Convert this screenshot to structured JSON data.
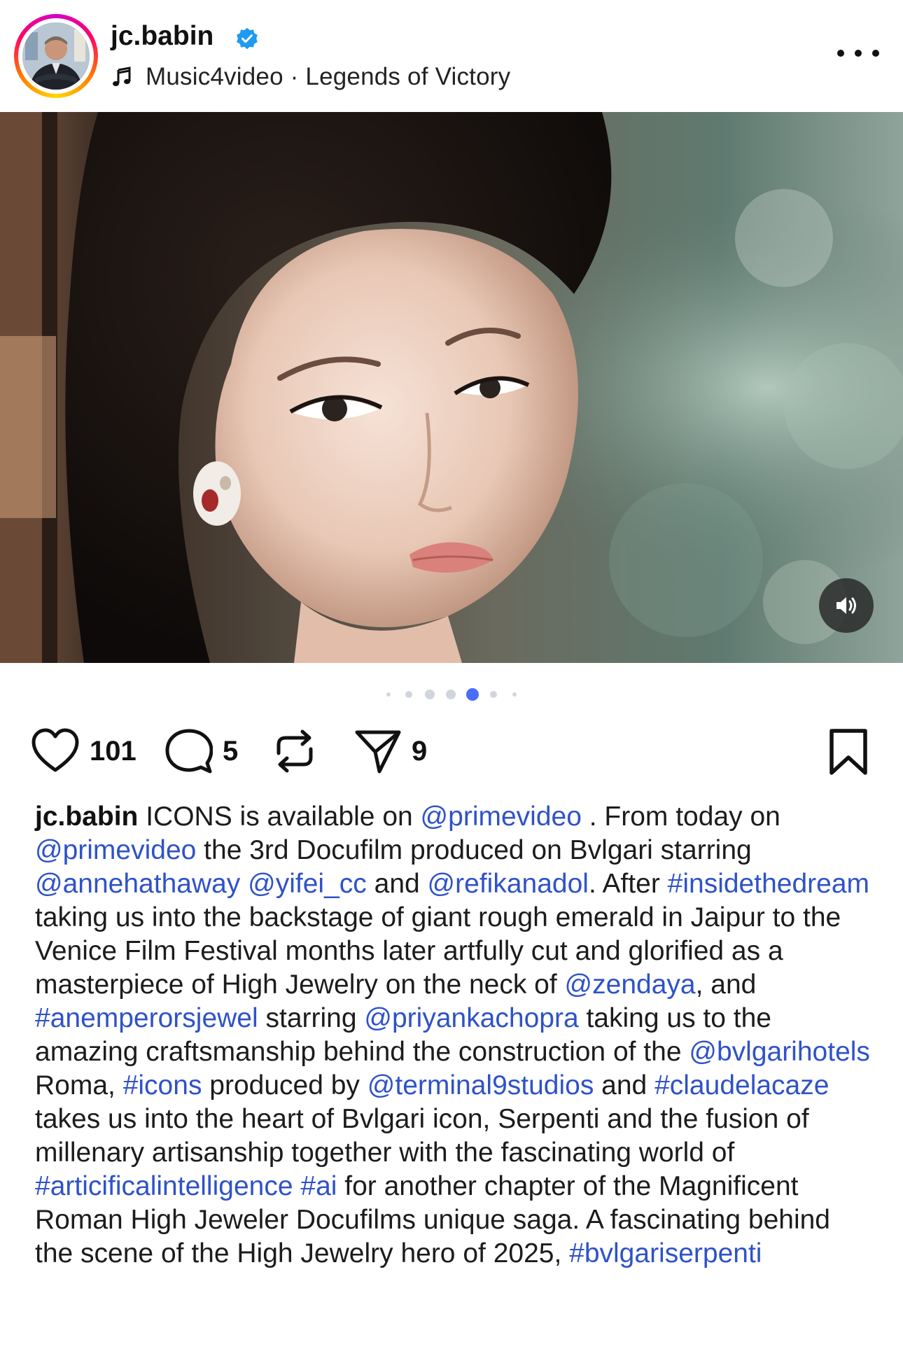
{
  "post": {
    "username": "jc.babin",
    "verified": true,
    "music_note_icon": "music-note-icon",
    "audio": "Music4video · Legends of Victory",
    "more_icon": "more-horizontal-icon"
  },
  "media": {
    "sound_icon": "speaker-volume-icon",
    "carousel_dots": 7,
    "active_dot_index": 4
  },
  "actions": {
    "likes": "101",
    "comments": "5",
    "shares": "9",
    "icons": [
      "heart-icon",
      "comment-icon",
      "repost-icon",
      "send-icon",
      "bookmark-icon"
    ]
  },
  "caption": {
    "segments": [
      {
        "t": "jc.babin",
        "k": "user"
      },
      {
        "t": " ICONS is available on ",
        "k": "text"
      },
      {
        "t": "@primevideo",
        "k": "link"
      },
      {
        "t": " . From today on ",
        "k": "text"
      },
      {
        "t": "@primevideo",
        "k": "link"
      },
      {
        "t": " the 3rd Docufilm produced on Bvlgari starring ",
        "k": "text"
      },
      {
        "t": "@annehathaway",
        "k": "link"
      },
      {
        "t": " ",
        "k": "text"
      },
      {
        "t": "@yifei_cc",
        "k": "link"
      },
      {
        "t": " and ",
        "k": "text"
      },
      {
        "t": "@refikanadol",
        "k": "link"
      },
      {
        "t": ". After ",
        "k": "text"
      },
      {
        "t": "#insidethedream",
        "k": "link"
      },
      {
        "t": " taking us into the backstage of giant rough emerald in Jaipur to the Venice Film Festival months later artfully cut and glorified as a masterpiece of High Jewelry on the neck of ",
        "k": "text"
      },
      {
        "t": "@zendaya",
        "k": "link"
      },
      {
        "t": ", and ",
        "k": "text"
      },
      {
        "t": "#anemperorsjewel",
        "k": "link"
      },
      {
        "t": " starring ",
        "k": "text"
      },
      {
        "t": "@priyankachopra",
        "k": "link"
      },
      {
        "t": " taking us to the amazing craftsmanship behind the construction of the ",
        "k": "text"
      },
      {
        "t": "@bvlgarihotels",
        "k": "link"
      },
      {
        "t": " Roma, ",
        "k": "text"
      },
      {
        "t": "#icons",
        "k": "link"
      },
      {
        "t": " produced by ",
        "k": "text"
      },
      {
        "t": "@terminal9studios",
        "k": "link"
      },
      {
        "t": " and ",
        "k": "text"
      },
      {
        "t": "#claudelacaze",
        "k": "link"
      },
      {
        "t": " takes us into the heart of Bvlgari icon, Serpenti and the fusion of millenary artisanship together with the fascinating world of ",
        "k": "text"
      },
      {
        "t": "#articificalintelligence",
        "k": "link"
      },
      {
        "t": " ",
        "k": "text"
      },
      {
        "t": "#ai",
        "k": "link"
      },
      {
        "t": " for another chapter of the Magnificent Roman High Jeweler Docufilms unique saga. A fascinating behind the scene of the High Jewelry hero of 2025, ",
        "k": "text"
      },
      {
        "t": "#bvlgariserpenti",
        "k": "link"
      }
    ]
  },
  "colors": {
    "link": "#2f52c9",
    "verified_badge": "#1d9bf0",
    "active_dot": "#4a6cf7",
    "inactive_dot": "#d1d6de"
  }
}
